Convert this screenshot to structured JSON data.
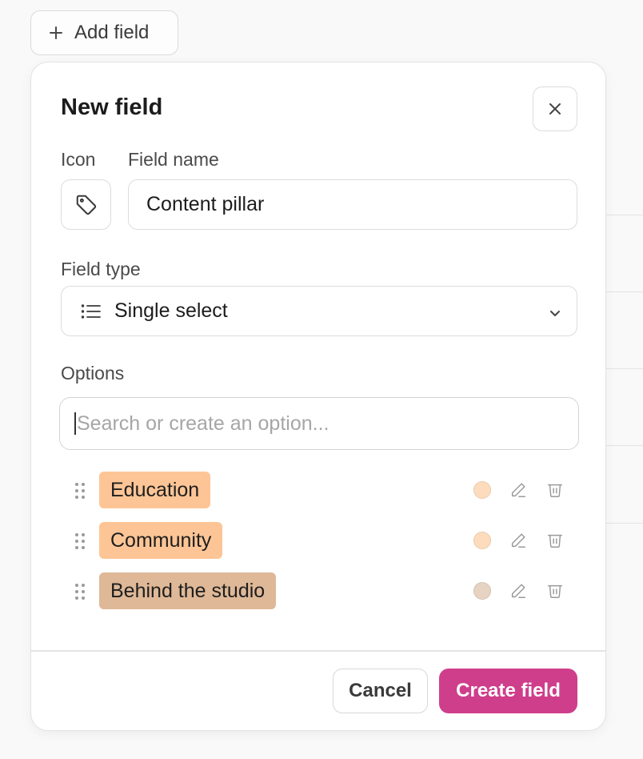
{
  "toolbar": {
    "add_field_label": "Add field",
    "add_icon": "plus-icon"
  },
  "modal": {
    "title": "New field",
    "close_icon": "close-icon",
    "icon_label": "Icon",
    "selected_icon": "tag-icon",
    "field_name_label": "Field name",
    "field_name_value": "Content pillar",
    "field_type_label": "Field type",
    "field_type_value": "Single select",
    "field_type_icon": "list-icon",
    "options_label": "Options",
    "search_placeholder": "Search or create an option...",
    "options": [
      {
        "label": "Education",
        "color": "#fdc596",
        "dot_color": "#fddcbd"
      },
      {
        "label": "Community",
        "color": "#fdc596",
        "dot_color": "#fddcbd"
      },
      {
        "label": "Behind the studio",
        "color": "#dfb897",
        "dot_color": "#e7d3c2"
      }
    ],
    "cancel_label": "Cancel",
    "create_label": "Create field"
  },
  "colors": {
    "accent": "#cf3e8b"
  }
}
